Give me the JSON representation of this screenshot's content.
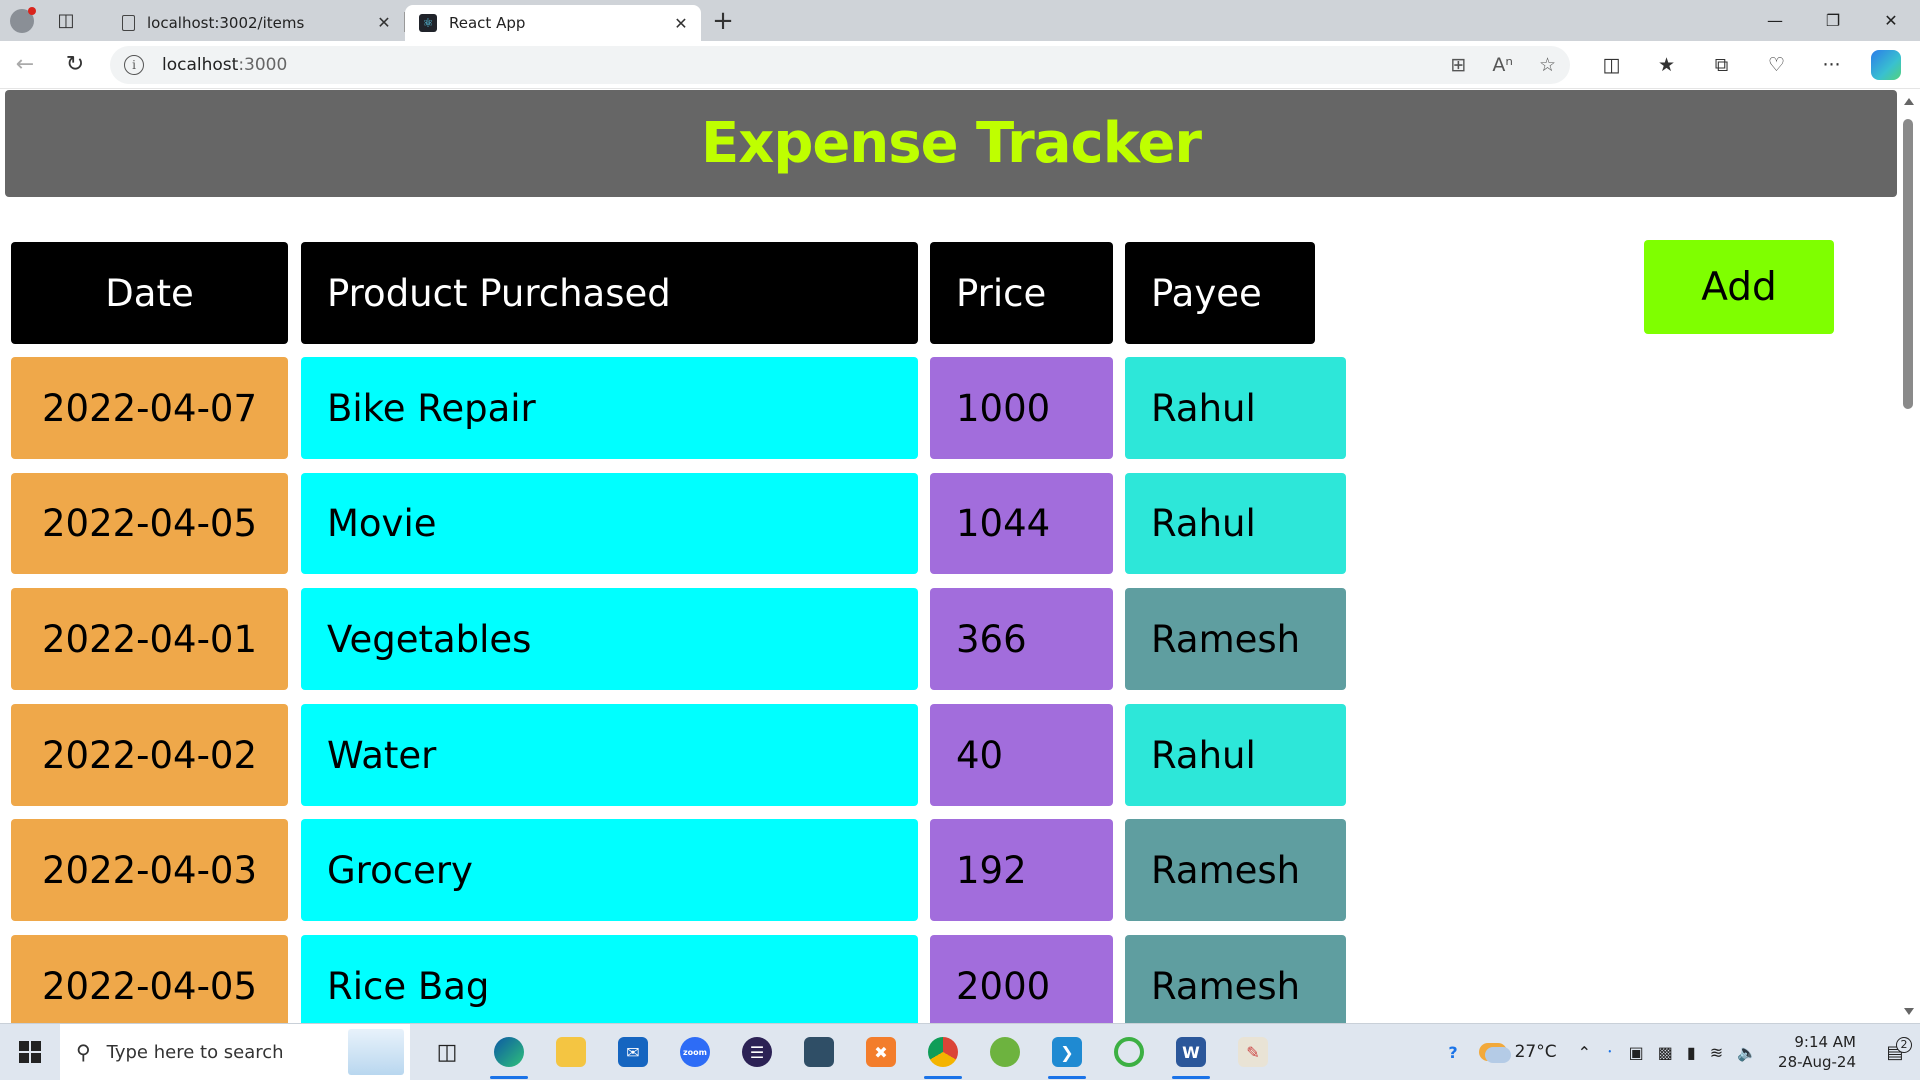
{
  "browser": {
    "tabs": [
      {
        "title": "localhost:3002/items",
        "active": false
      },
      {
        "title": "React App",
        "active": true
      }
    ],
    "new_tab": "+",
    "url": {
      "host": "localhost",
      "port": ":3000"
    }
  },
  "page": {
    "title": "Expense Tracker",
    "add_button": "Add",
    "columns": [
      "Date",
      "Product Purchased",
      "Price",
      "Payee"
    ],
    "rows": [
      {
        "date": "2022-04-07",
        "product": "Bike Repair",
        "price": "1000",
        "payee": "Rahul"
      },
      {
        "date": "2022-04-05",
        "product": "Movie",
        "price": "1044",
        "payee": "Rahul"
      },
      {
        "date": "2022-04-01",
        "product": "Vegetables",
        "price": "366",
        "payee": "Ramesh"
      },
      {
        "date": "2022-04-02",
        "product": "Water",
        "price": "40",
        "payee": "Rahul"
      },
      {
        "date": "2022-04-03",
        "product": "Grocery",
        "price": "192",
        "payee": "Ramesh"
      },
      {
        "date": "2022-04-05",
        "product": "Rice Bag",
        "price": "2000",
        "payee": "Ramesh"
      }
    ],
    "colors": {
      "header_bg": "#666666",
      "title": "#bfff00",
      "date_cell": "#efa84a",
      "product_cell": "#00ffff",
      "price_cell": "#a26ddc",
      "payee_rahul": "#2de7d9",
      "payee_ramesh": "#5f9ea0",
      "add_button": "#7fff00"
    }
  },
  "taskbar": {
    "search_placeholder": "Type here to search",
    "temperature": "27°C",
    "time": "9:14 AM",
    "date": "28-Aug-24",
    "notifications": "2",
    "apps": [
      "edge",
      "file-explorer",
      "mail",
      "zoom",
      "eclipse",
      "mysql-workbench",
      "xampp",
      "chrome",
      "spring-tools",
      "vscode",
      "refresh-app",
      "word",
      "paint"
    ]
  }
}
